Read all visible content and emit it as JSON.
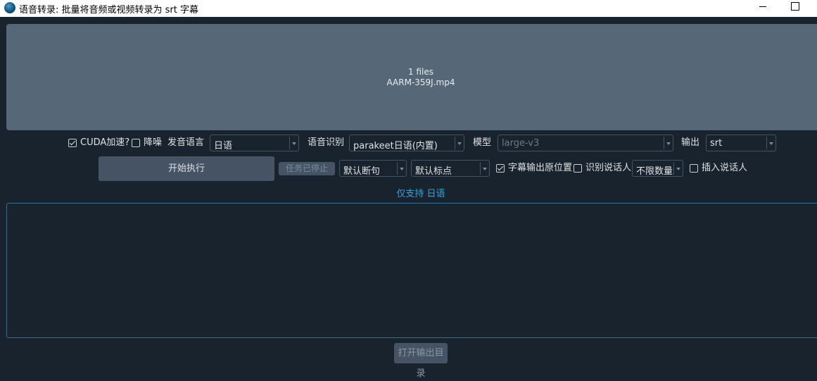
{
  "window": {
    "title": "语音转录: 批量将音频或视频转录为 srt 字幕",
    "icon": "app-globe-icon"
  },
  "dropzone": {
    "count": "1 files",
    "file": "AARM-359J.mp4"
  },
  "options": {
    "cuda_label": "CUDA加速?",
    "cuda_checked": true,
    "denoise_label": "降噪",
    "denoise_checked": false,
    "lang_label": "发音语言",
    "lang_value": "日语",
    "asr_label": "语音识别",
    "asr_value": "parakeet日语(内置)",
    "model_label": "模型",
    "model_value": "large-v3",
    "output_label": "输出",
    "output_value": "srt"
  },
  "actions": {
    "start_label": "开始执行",
    "stopped_label": "任务已停止",
    "split_value": "默认断句",
    "punct_value": "默认标点",
    "subtitle_pos_label": "字幕输出原位置",
    "subtitle_pos_checked": true,
    "speaker_label": "识别说话人",
    "speaker_checked": false,
    "speaker_count_value": "不限数量",
    "insert_speaker_label": "插入说话人",
    "insert_speaker_checked": false
  },
  "hint": "仅支持 日语",
  "open_dir_label": "打开输出目录",
  "colors": {
    "background": "#19232d",
    "dropzone": "#566878",
    "button": "#455364",
    "accent": "#37a2e0"
  }
}
